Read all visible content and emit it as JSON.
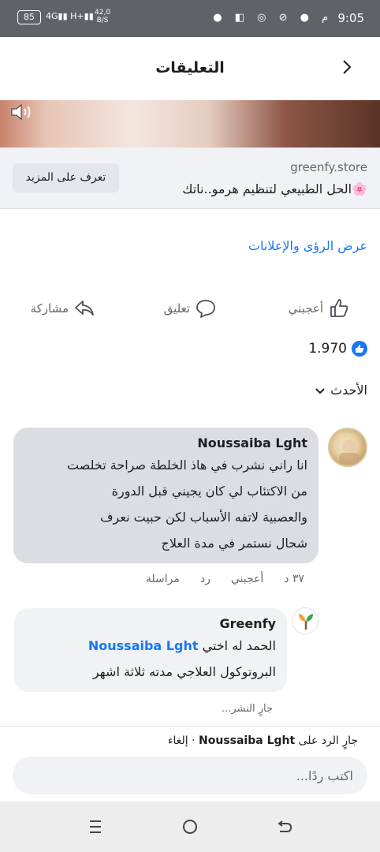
{
  "status_bar": {
    "time": "9:05",
    "ampm": "م",
    "battery": "85",
    "network": "4G",
    "network2": "H+",
    "speed_value": "42,0",
    "speed_unit": "B/S"
  },
  "header": {
    "title": "التعليقات"
  },
  "ad": {
    "domain": "greenfy.store",
    "headline": "الحل الطبيعي لتنظيم هرمو..ناتك🌸",
    "cta_label": "تعرف على المزيد"
  },
  "insights_link": "عرض الرؤى والإعلانات",
  "actions": {
    "like": "أعجبني",
    "comment": "تعليق",
    "share": "مشاركة"
  },
  "reactions": {
    "count": "1.970"
  },
  "sort": {
    "label": "الأحدث"
  },
  "comments": [
    {
      "author": "Noussaiba Lght",
      "lines": [
        "انا راني نشرب في هاذ الخلطة صراحة تخلصت",
        "من الاكتئاب لي كان يجيني قبل الدورة",
        "والعصبية لاتفه الأسباب   لكن حبيت نعرف",
        "شحال نستمر في مدة العلاج"
      ],
      "time": "٣٧ د",
      "like": "أعجبني",
      "reply": "رد",
      "message": "مراسلة"
    },
    {
      "author": "Greenfy",
      "prefix": "الحمد له اختي",
      "mention": "Noussaiba Lght",
      "line2": "البروتوكول العلاجي مدته ثلاثة اشهر",
      "status": "جارٍ النشر..."
    }
  ],
  "reply_bar": {
    "replying_prefix": "جارٍ الرد على",
    "replying_name": "Noussaiba Lght",
    "cancel": "· إلغاء",
    "placeholder": "اكتب ردًا..."
  },
  "colors": {
    "accent": "#1877f2",
    "status_bar": "#5f6368",
    "bubble": "#dcdde2"
  }
}
